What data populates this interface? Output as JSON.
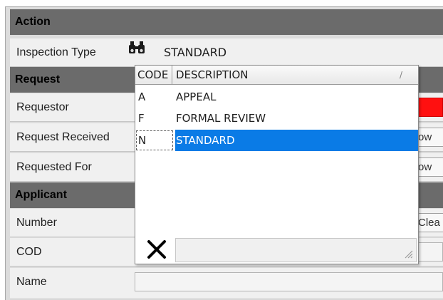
{
  "sections": {
    "action": "Action",
    "request": "Request",
    "applicant": "Applicant"
  },
  "fields": {
    "inspection_type": {
      "label": "Inspection Type",
      "value": "STANDARD",
      "icon": "binoculars-icon"
    },
    "requestor": {
      "label": "Requestor"
    },
    "request_received": {
      "label": "Request Received",
      "button_label": "ow"
    },
    "requested_for": {
      "label": "Requested For",
      "button_label": "ow"
    },
    "number": {
      "label": "Number",
      "button_label": "Clea"
    },
    "cod": {
      "label": "COD"
    },
    "name": {
      "label": "Name"
    }
  },
  "dropdown": {
    "columns": {
      "code": "CODE",
      "description": "DESCRIPTION",
      "sort_mark": "/"
    },
    "rows": [
      {
        "code": "A",
        "description": "APPEAL",
        "selected": false
      },
      {
        "code": "F",
        "description": "FORMAL REVIEW",
        "selected": false
      },
      {
        "code": "N",
        "description": "STANDARD",
        "selected": true
      }
    ],
    "close_icon": "close-x-icon"
  },
  "colors": {
    "section_header": "#6b6b6b",
    "selection": "#0a7be6",
    "required_field": "#ff1010"
  }
}
